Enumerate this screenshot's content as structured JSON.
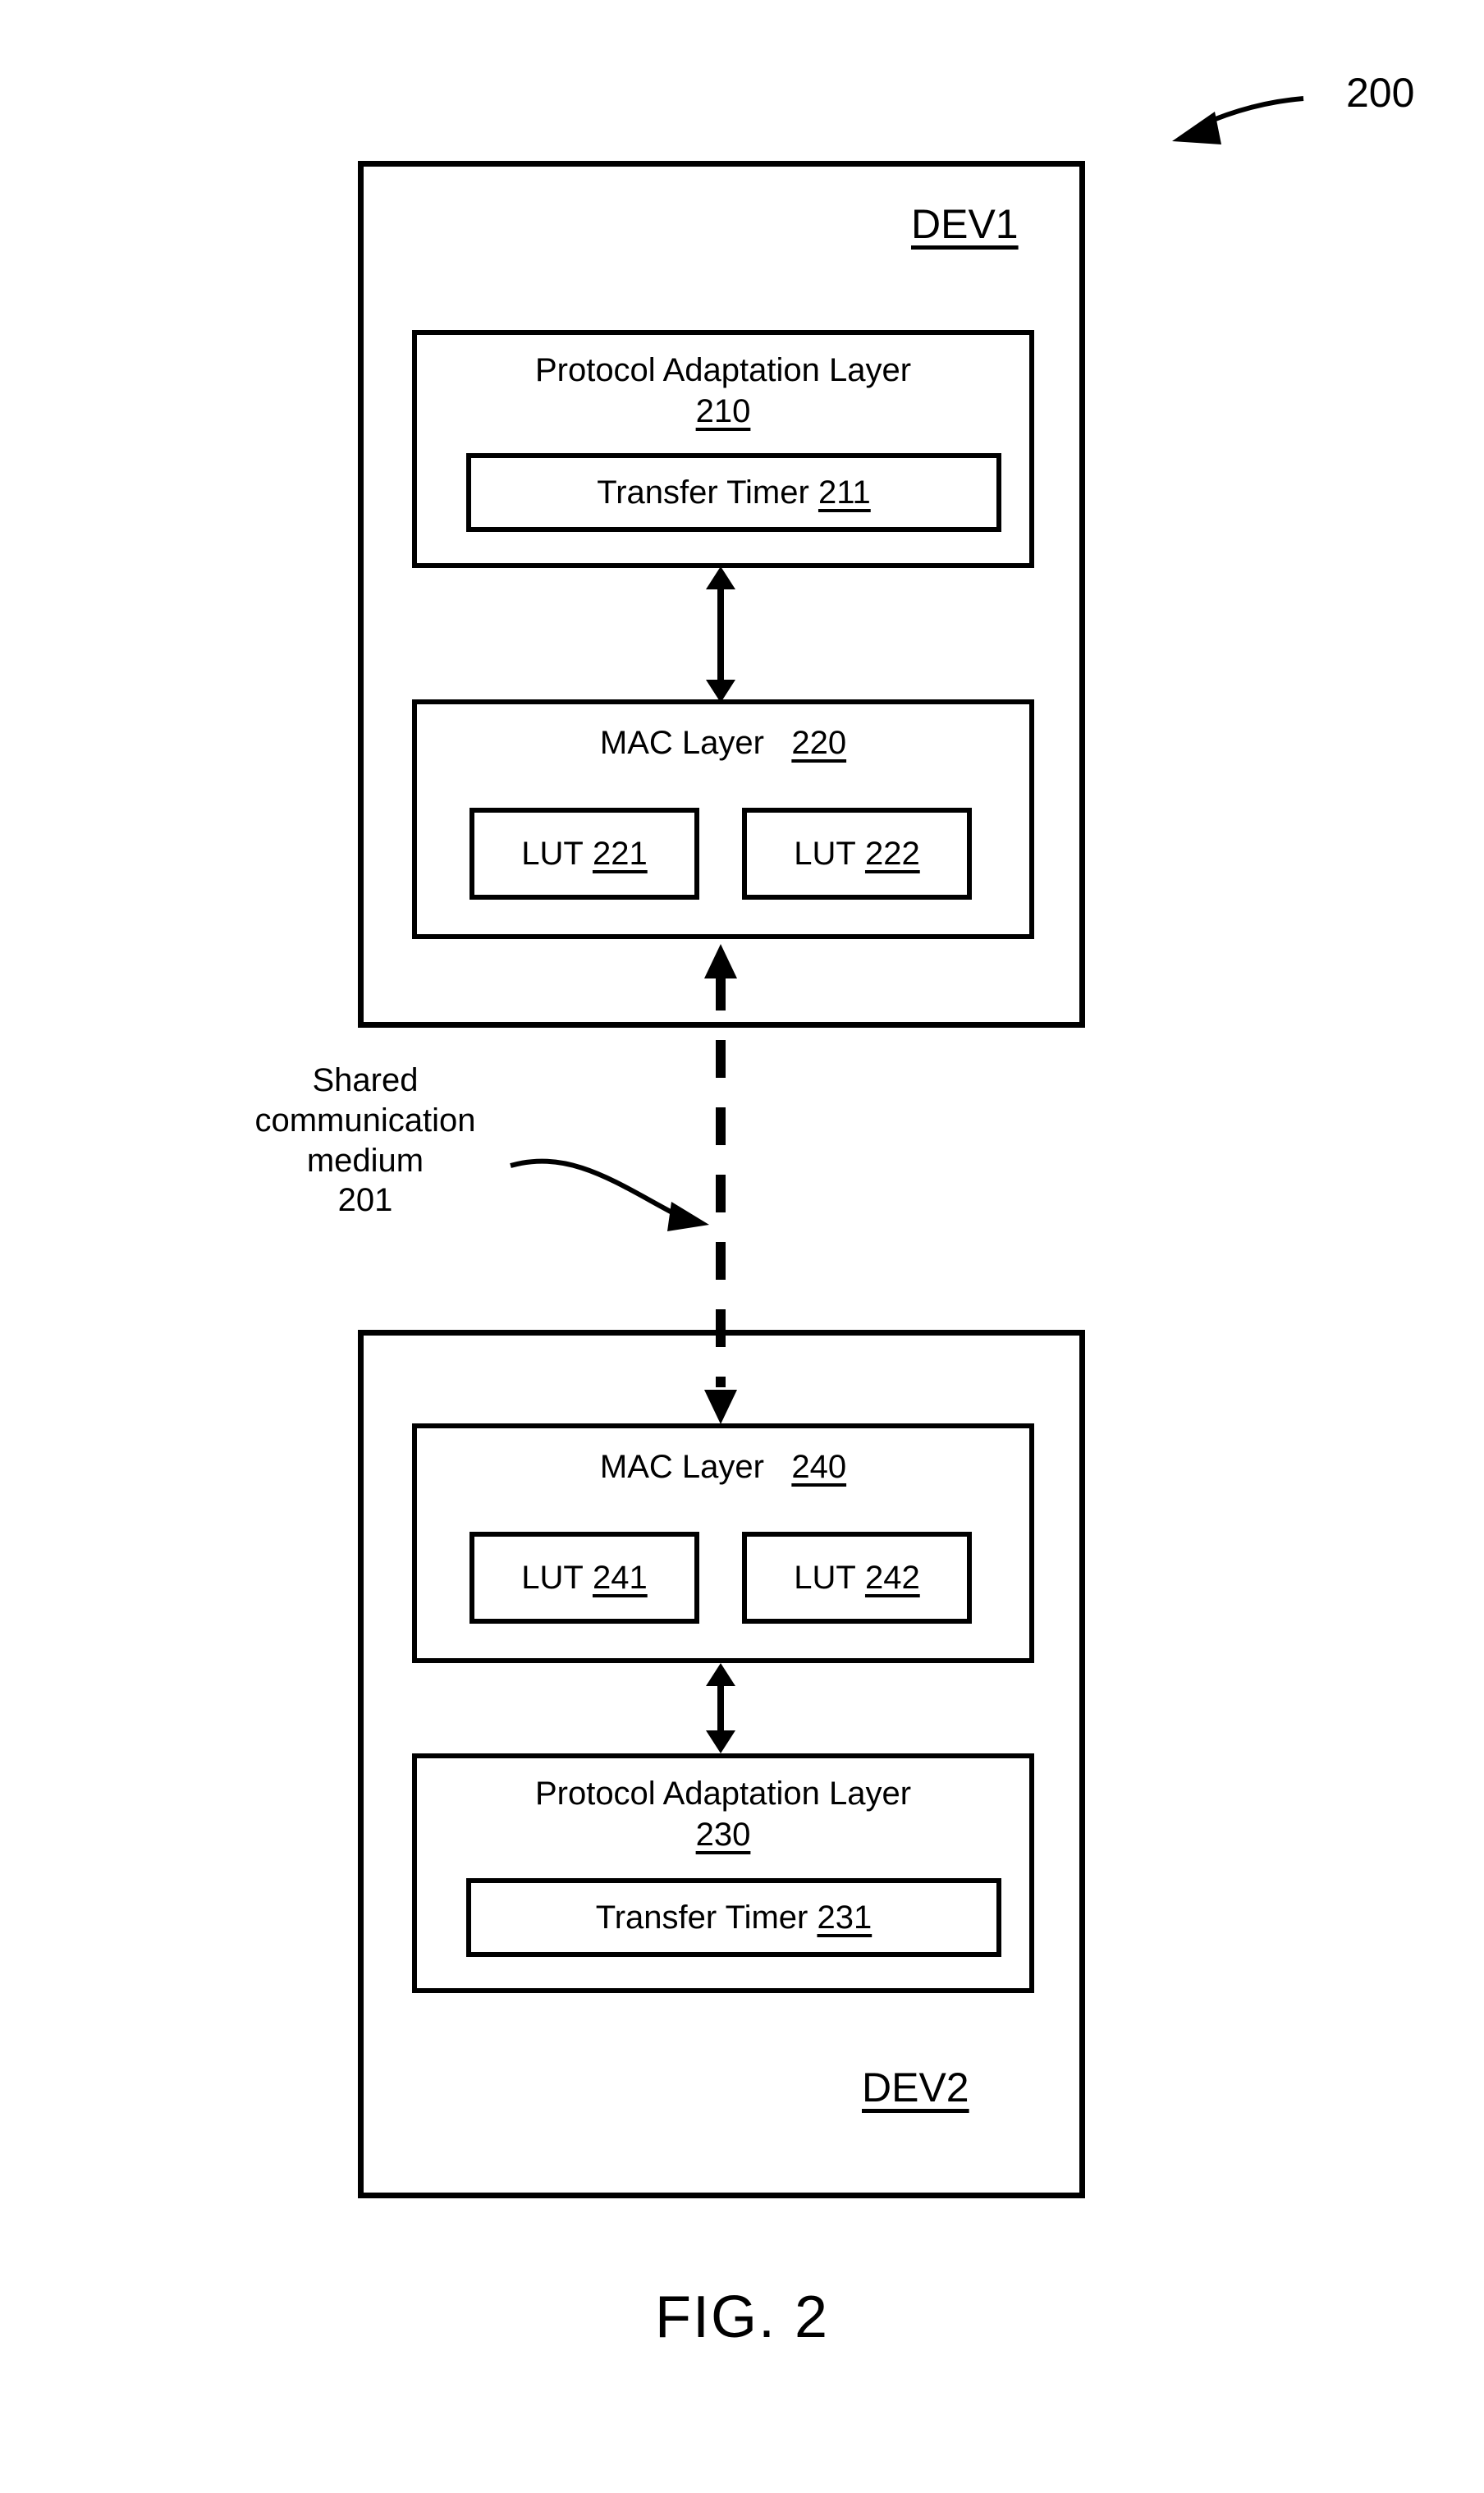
{
  "figure": {
    "caption": "FIG. 2",
    "reference_numeral": "200"
  },
  "devices": [
    {
      "id": "dev1",
      "label": "DEV1",
      "layers": [
        {
          "id": "pal210",
          "title": "Protocol Adaptation Layer",
          "ref": "210",
          "children": [
            {
              "id": "tt211",
              "label": "Transfer Timer",
              "ref": "211"
            }
          ]
        },
        {
          "id": "mac220",
          "title": "MAC Layer",
          "ref": "220",
          "children": [
            {
              "id": "lut221",
              "label": "LUT",
              "ref": "221"
            },
            {
              "id": "lut222",
              "label": "LUT",
              "ref": "222"
            }
          ]
        }
      ]
    },
    {
      "id": "dev2",
      "label": "DEV2",
      "layers": [
        {
          "id": "mac240",
          "title": "MAC Layer",
          "ref": "240",
          "children": [
            {
              "id": "lut241",
              "label": "LUT",
              "ref": "241"
            },
            {
              "id": "lut242",
              "label": "LUT",
              "ref": "242"
            }
          ]
        },
        {
          "id": "pal230",
          "title": "Protocol Adaptation Layer",
          "ref": "230",
          "children": [
            {
              "id": "tt231",
              "label": "Transfer Timer",
              "ref": "231"
            }
          ]
        }
      ]
    }
  ],
  "annotations": {
    "medium_label_line1": "Shared",
    "medium_label_line2": "communication",
    "medium_label_line3": "medium",
    "medium_ref": "201"
  },
  "colors": {
    "stroke": "#000000",
    "background": "#ffffff"
  }
}
